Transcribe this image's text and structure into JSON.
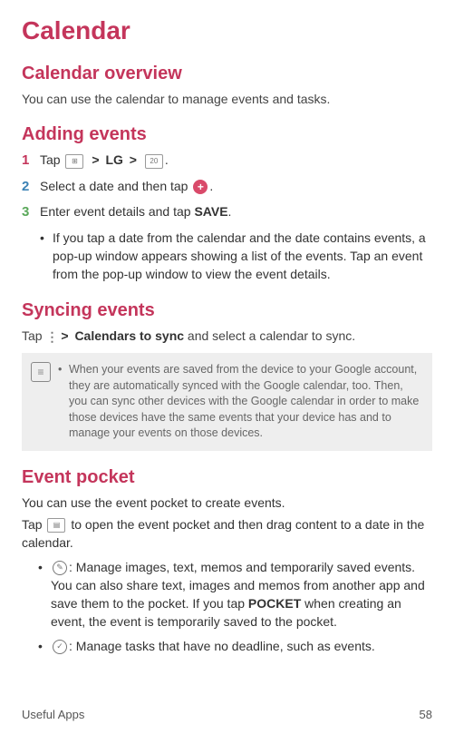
{
  "page": {
    "title": "Calendar"
  },
  "overview": {
    "heading": "Calendar overview",
    "text": "You can use the calendar to manage events and tasks."
  },
  "adding": {
    "heading": "Adding events",
    "s1_tap": "Tap",
    "s1_sep": ">",
    "s1_lg": "LG",
    "s1_period": ".",
    "calendar_icon_text": "20",
    "s2_a": "Select a date and then tap",
    "s2_period": ".",
    "plus_sign": "+",
    "s3_a": "Enter event details and tap ",
    "s3_save": "SAVE",
    "s3_period": ".",
    "note1": "If you tap a date from the calendar and the date contains events, a pop-up window appears showing a list of the events. Tap an event from the pop-up window to view the event details."
  },
  "syncing": {
    "heading": "Syncing events",
    "tap": "Tap",
    "sep": ">",
    "bold": "Calendars to sync",
    "rest": " and select a calendar to sync.",
    "note": "When your events are saved from the device to your Google account, they are automatically synced with the Google calendar, too. Then, you can sync other devices with the Google calendar in order to make those devices have the same events that your device has and to manage your events on those devices."
  },
  "pocket": {
    "heading": "Event pocket",
    "intro1": "You can use the event pocket to create events.",
    "intro2_a": "Tap",
    "intro2_b": "to open the event pocket and then drag content to a date in the calendar.",
    "item1_a": ": Manage images, text, memos and temporarily saved events. You can also share text, images and memos from another app and save them to the pocket. If you tap ",
    "item1_bold": "POCKET",
    "item1_b": " when creating an event, the event is temporarily saved to the pocket.",
    "item2": ": Manage tasks that have no deadline, such as events."
  },
  "footer": {
    "left": "Useful Apps",
    "right": "58"
  }
}
